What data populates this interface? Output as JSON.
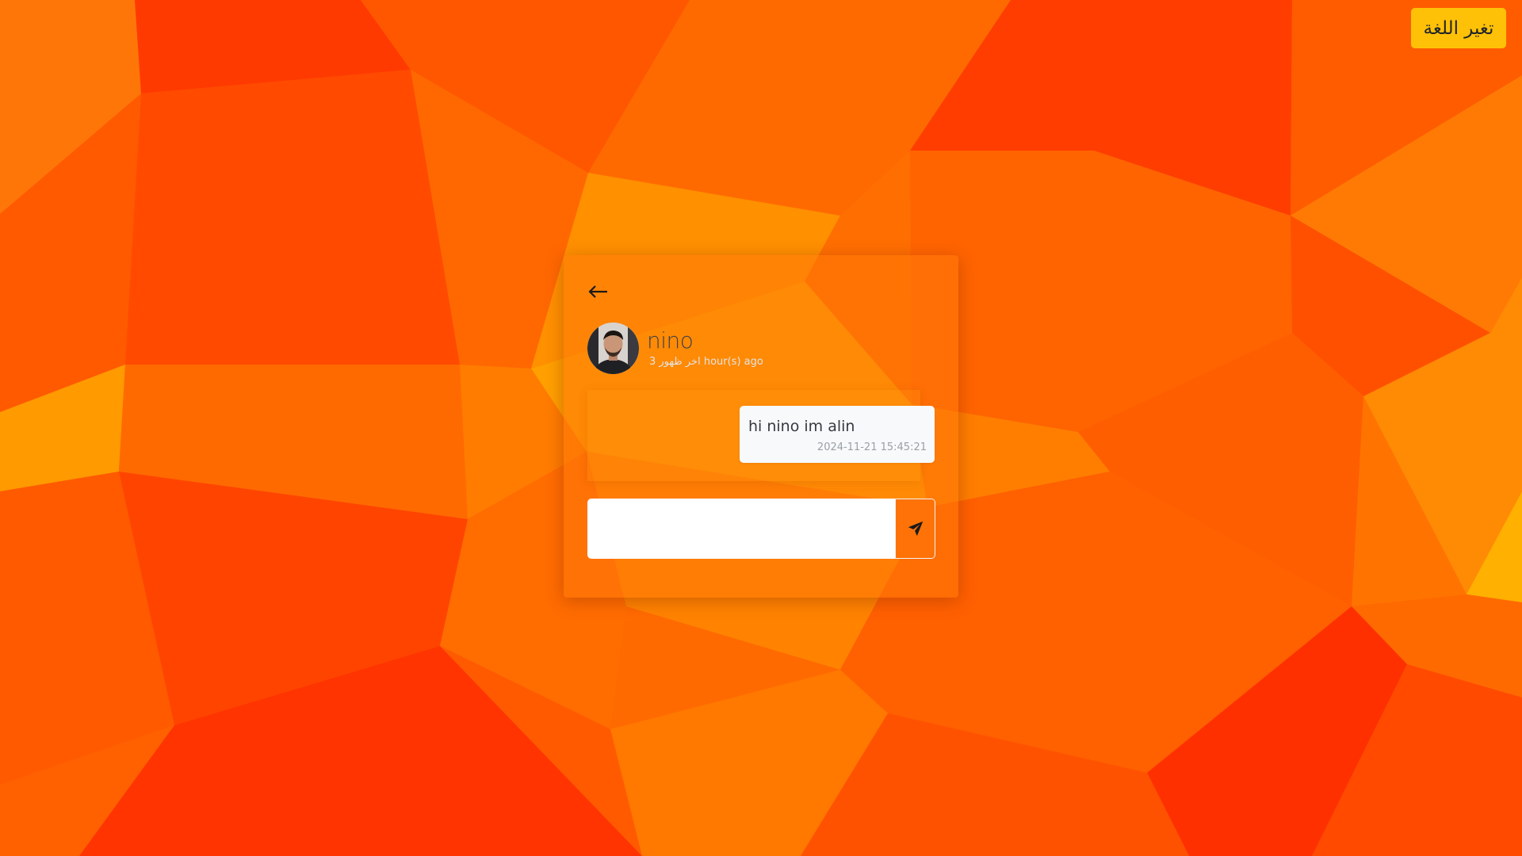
{
  "header": {
    "language_button_label": "تغير اللغة"
  },
  "chat": {
    "back_icon": "arrow-left-icon",
    "contact": {
      "name": "nino",
      "last_seen": "3 اخر ظهور hour(s) ago",
      "avatar": "profile-photo"
    },
    "messages": [
      {
        "text": "hi nino im alin",
        "timestamp": "2024-11-21 15:45:21"
      }
    ],
    "composer": {
      "value": "",
      "send_icon": "paper-plane-icon"
    }
  },
  "colors": {
    "background": "#ff6a00",
    "language_button": "#ffc107",
    "message_bubble": "#f8f9fa"
  }
}
